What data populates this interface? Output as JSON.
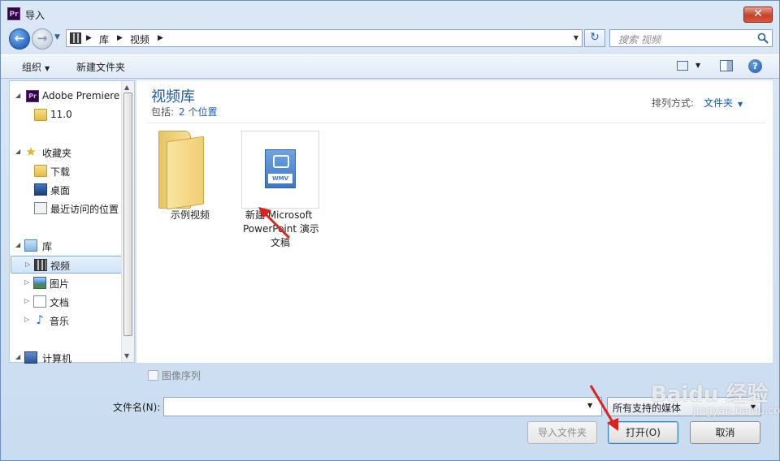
{
  "window": {
    "title": "导入",
    "app_icon_text": "Pr",
    "close_label": "✕"
  },
  "address": {
    "crumbs": [
      "库",
      "视频"
    ],
    "search_placeholder": "搜索 视频"
  },
  "toolbar": {
    "organize_label": "组织",
    "new_folder_label": "新建文件夹",
    "help_label": "?"
  },
  "nav": {
    "items": [
      {
        "label": "Adobe Premiere"
      },
      {
        "label": "11.0"
      },
      {
        "label": "收藏夹"
      },
      {
        "label": "下载"
      },
      {
        "label": "桌面"
      },
      {
        "label": "最近访问的位置"
      },
      {
        "label": "库"
      },
      {
        "label": "视频"
      },
      {
        "label": "图片"
      },
      {
        "label": "文档"
      },
      {
        "label": "音乐"
      },
      {
        "label": "计算机"
      }
    ]
  },
  "content": {
    "title": "视频库",
    "includes_label": "包括:",
    "locations_link": "2 个位置",
    "sort_label": "排列方式:",
    "sort_value": "文件夹",
    "files": [
      {
        "name": "示例视频"
      },
      {
        "name_line1": "新建 Microsoft",
        "name_line2": "PowerPoint 演示",
        "name_line3": "文稿",
        "badge": "WMV"
      }
    ]
  },
  "bottom": {
    "image_sequence_label": "图像序列",
    "filename_label": "文件名(N):",
    "filename_value": "",
    "filter_value": "所有支持的媒体",
    "import_folder_label": "导入文件夹",
    "open_label": "打开(O)",
    "cancel_label": "取消"
  },
  "watermark": {
    "text": "Baidu 经验",
    "sub": "jingyan.baidu.com"
  },
  "colors": {
    "accent": "#1e5a9e",
    "link": "#1a5fb4",
    "annotation_arrow": "#e0201a"
  }
}
